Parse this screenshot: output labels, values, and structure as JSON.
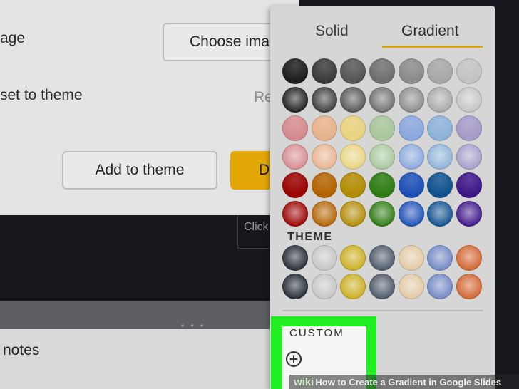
{
  "background_dialog": {
    "image_label": "age",
    "choose_image_button": "Choose ima",
    "reset_label": "set to theme",
    "reset_link": "Re",
    "add_to_theme_button": "Add to theme",
    "done_button": "D"
  },
  "slide": {
    "click_hint": "Click"
  },
  "notes": {
    "label": "notes"
  },
  "color_picker": {
    "tabs": [
      {
        "label": "Solid"
      },
      {
        "label": "Gradient"
      }
    ],
    "active_tab": "Gradient",
    "accent_color": "#e0a400",
    "gradient_rows": [
      [
        "#1c1c1c",
        "#3a3a3a",
        "#545454",
        "#6e6e6e",
        "#8a8a8a",
        "#a6a6a6",
        "#c2c2c2"
      ],
      [
        "#1c1c1c",
        "#3a3a3a",
        "#545454",
        "#6e6e6e",
        "#8a8a8a",
        "#a6a6a6",
        "#c2c2c2"
      ],
      [
        "#d48a8f",
        "#e6b28c",
        "#e8d27e",
        "#a7c69a",
        "#8aa6dc",
        "#8cb1d8",
        "#a59ac8"
      ],
      [
        "#d48a8f",
        "#e6b28c",
        "#e8d27e",
        "#a7c69a",
        "#8aa6dc",
        "#8cb1d8",
        "#a59ac8"
      ],
      [
        "#9a0000",
        "#b26200",
        "#b08a00",
        "#2a7a10",
        "#1a4eb4",
        "#0e4f8c",
        "#3c1486"
      ],
      [
        "#9a0000",
        "#b26200",
        "#b08a00",
        "#2a7a10",
        "#1a4eb4",
        "#0e4f8c",
        "#3c1486"
      ]
    ],
    "theme_label": "THEME",
    "theme_rows": [
      [
        "#202830",
        "#c4c4c4",
        "#c9ac1c",
        "#4a5566",
        "#e2c7a2",
        "#7086c4",
        "#d0622c"
      ],
      [
        "#202830",
        "#c4c4c4",
        "#c9ac1c",
        "#4a5566",
        "#e2c7a2",
        "#7086c4",
        "#d0622c"
      ]
    ],
    "custom_label": "CUSTOM",
    "highlight_color": "#22ef22",
    "add_custom_icon": "add-circle-icon"
  },
  "watermark": {
    "brand": "wiki",
    "text": "How to Create a Gradient in Google Slides"
  }
}
